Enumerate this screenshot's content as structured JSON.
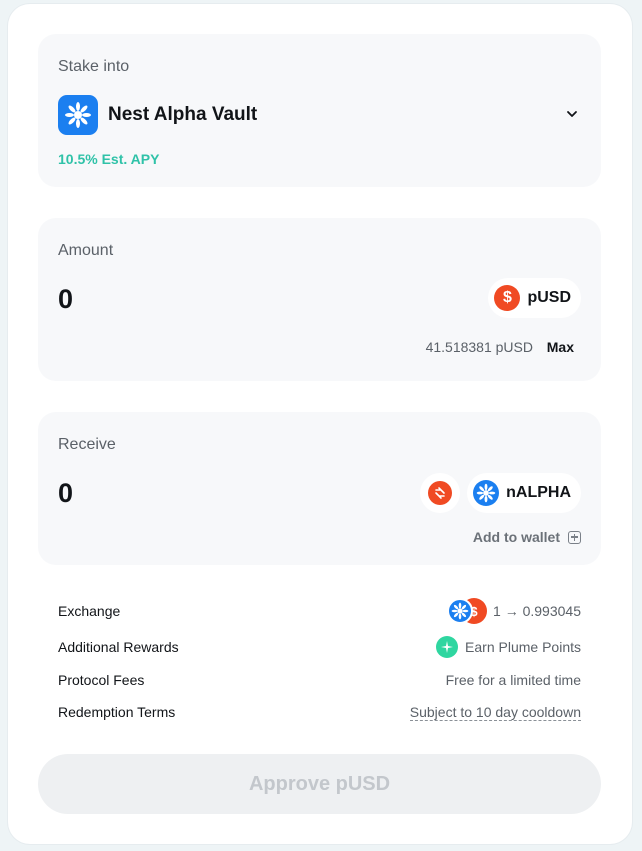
{
  "stake_into": {
    "label": "Stake into",
    "vault_name": "Nest Alpha Vault",
    "apy": "10.5% Est. APY"
  },
  "amount": {
    "label": "Amount",
    "value": "0",
    "token": "pUSD",
    "balance": "41.518381 pUSD",
    "max_label": "Max"
  },
  "receive": {
    "label": "Receive",
    "value": "0",
    "token": "nALPHA",
    "add_to_wallet": "Add to wallet"
  },
  "details": [
    {
      "key": "Exchange",
      "value": "1 → 0.993045"
    },
    {
      "key": "Additional Rewards",
      "value": "Earn Plume Points"
    },
    {
      "key": "Protocol Fees",
      "value": "Free for a limited time"
    },
    {
      "key": "Redemption Terms",
      "value": "Subject to 10 day cooldown"
    }
  ],
  "approve_button": "Approve pUSD",
  "colors": {
    "accent_blue": "#1b7ff0",
    "pusd_red": "#f04a23",
    "apy_green": "#2fc2a8",
    "plume_green": "#2fd6a0"
  },
  "icons": {
    "vault": "daisy-icon",
    "dropdown": "chevron-down-icon",
    "pusd": "dollar-coin-icon",
    "swap": "swap-icon",
    "nalpha": "daisy-coin-icon",
    "add": "plus-square-icon",
    "plume": "sparkle-icon"
  }
}
